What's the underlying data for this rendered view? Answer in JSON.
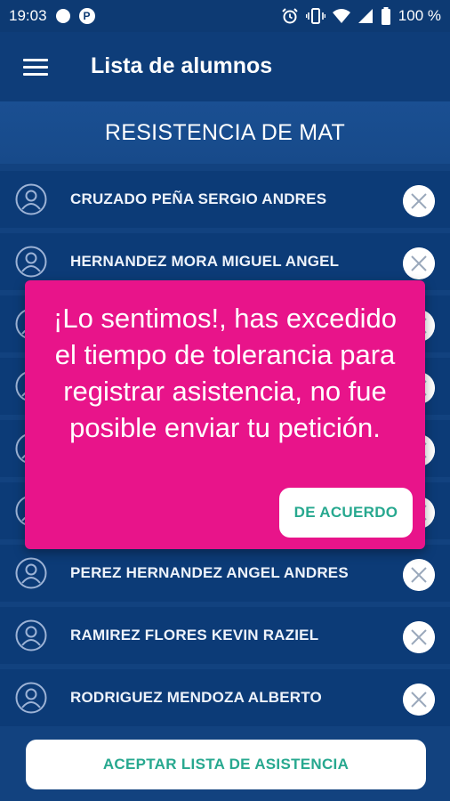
{
  "status_bar": {
    "time": "19:03",
    "p_label": "P",
    "battery": "100 %"
  },
  "header": {
    "title": "Lista de alumnos",
    "menu_icon": "hamburger-menu-icon"
  },
  "subject": "RESISTENCIA DE MAT",
  "students": [
    {
      "name": "CRUZADO PEÑA SERGIO ANDRES"
    },
    {
      "name": "HERNANDEZ MORA MIGUEL ANGEL"
    },
    {
      "name": ""
    },
    {
      "name": ""
    },
    {
      "name": ""
    },
    {
      "name": ""
    },
    {
      "name": "PEREZ HERNANDEZ ANGEL ANDRES"
    },
    {
      "name": "RAMIREZ FLORES KEVIN RAZIEL"
    },
    {
      "name": "RODRIGUEZ MENDOZA ALBERTO"
    }
  ],
  "dialog": {
    "message": "¡Lo sentimos!, has excedido el tiempo de tolerancia para registrar asistencia, no fue posible enviar tu petición.",
    "button_label": "DE ACUERDO",
    "color": "#e8148a"
  },
  "footer": {
    "accept_label": "ACEPTAR LISTA DE ASISTENCIA"
  },
  "colors": {
    "primary": "#0e3d79",
    "accent_text": "#27a88f"
  }
}
